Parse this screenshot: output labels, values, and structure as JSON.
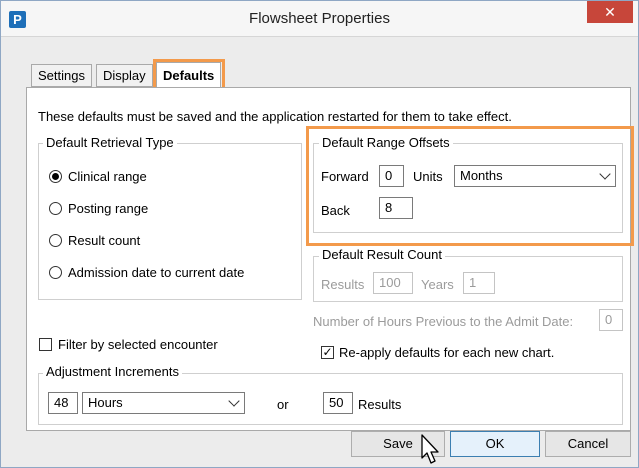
{
  "window": {
    "title": "Flowsheet Properties",
    "app_icon": "P",
    "close_glyph": "✕"
  },
  "tabs": [
    {
      "label": "Settings",
      "active": false
    },
    {
      "label": "Display",
      "active": false
    },
    {
      "label": "Defaults",
      "active": true
    }
  ],
  "notice": "These defaults must be saved and the application restarted for them to take effect.",
  "retrieval": {
    "legend": "Default Retrieval Type",
    "options": [
      {
        "label": "Clinical range",
        "checked": true
      },
      {
        "label": "Posting range",
        "checked": false
      },
      {
        "label": "Result count",
        "checked": false
      },
      {
        "label": "Admission date to current date",
        "checked": false
      }
    ]
  },
  "range_offsets": {
    "legend": "Default Range Offsets",
    "forward_label": "Forward",
    "forward_value": "0",
    "units_label": "Units",
    "units_value": "Months",
    "back_label": "Back",
    "back_value": "8"
  },
  "result_count": {
    "legend": "Default Result Count",
    "results_label": "Results",
    "results_value": "100",
    "years_label": "Years",
    "years_value": "1"
  },
  "hours_previous": {
    "label": "Number of Hours Previous to the Admit Date:",
    "value": "0"
  },
  "filter_encounter": {
    "label": "Filter by selected encounter",
    "checked": false
  },
  "reapply": {
    "label": "Re-apply defaults for each new chart.",
    "checked": true
  },
  "adjustment": {
    "legend": "Adjustment Increments",
    "amount": "48",
    "unit": "Hours",
    "or_label": "or",
    "results_amount": "50",
    "results_label": "Results"
  },
  "buttons": {
    "save": "Save",
    "ok": "OK",
    "cancel": "Cancel"
  },
  "colors": {
    "highlight": "#f39a4b",
    "close": "#c7463a"
  }
}
